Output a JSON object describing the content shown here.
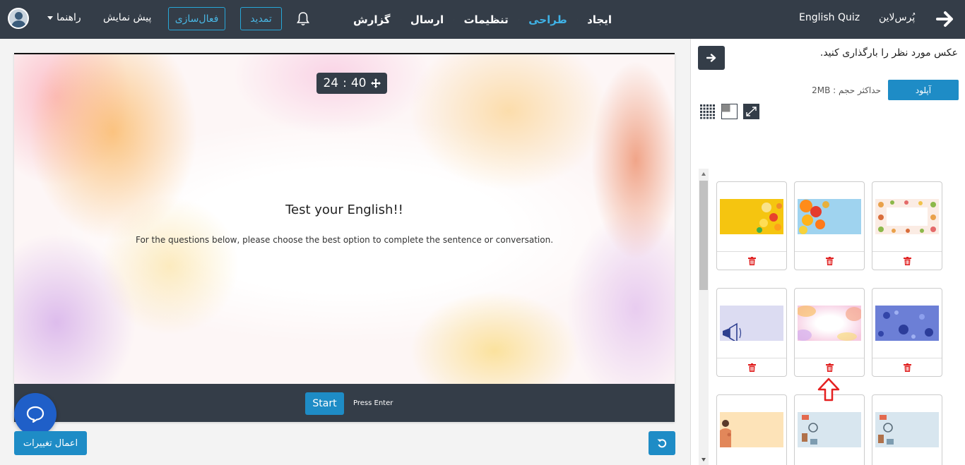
{
  "topbar": {
    "brand": "پُرس‌لاین",
    "quiz_name": "English Quiz",
    "breadcrumbs": [
      {
        "label": "ایجاد",
        "active": false
      },
      {
        "label": "طراحی",
        "active": true
      },
      {
        "label": "تنظیمات",
        "active": false
      },
      {
        "label": "ارسال",
        "active": false
      },
      {
        "label": "گزارش",
        "active": false
      }
    ],
    "renew_label": "تمدید",
    "activate_label": "فعال‌سازی",
    "preview_label": "پیش نمایش",
    "guide_label": "راهنما",
    "accent_color": "#3fb2e6"
  },
  "preview": {
    "timer_minutes": "40",
    "timer_seconds": "24",
    "timer_separator": ":",
    "title": "Test your English!!",
    "description": "For the questions below, please choose the best option to complete the sentence or conversation.",
    "start_label": "Start",
    "press_enter": "Press Enter"
  },
  "actions": {
    "apply_label": "اعمال تغییرات"
  },
  "panel": {
    "title": "عکس مورد نظر را بارگذاری کنید.",
    "upload_label": "آپلود",
    "max_size_label": "حداکثر حجم : 2MB",
    "display_modes": [
      "stretch-icon",
      "half-icon",
      "tile-icon"
    ],
    "thumbnails": [
      {
        "name": "yellow-fruits"
      },
      {
        "name": "citrus-blue"
      },
      {
        "name": "food-frame"
      },
      {
        "name": "lavender-megaphone"
      },
      {
        "name": "watercolor"
      },
      {
        "name": "virus-blue"
      },
      {
        "name": "peach-person"
      },
      {
        "name": "study-items-1"
      },
      {
        "name": "study-items-2"
      }
    ]
  }
}
